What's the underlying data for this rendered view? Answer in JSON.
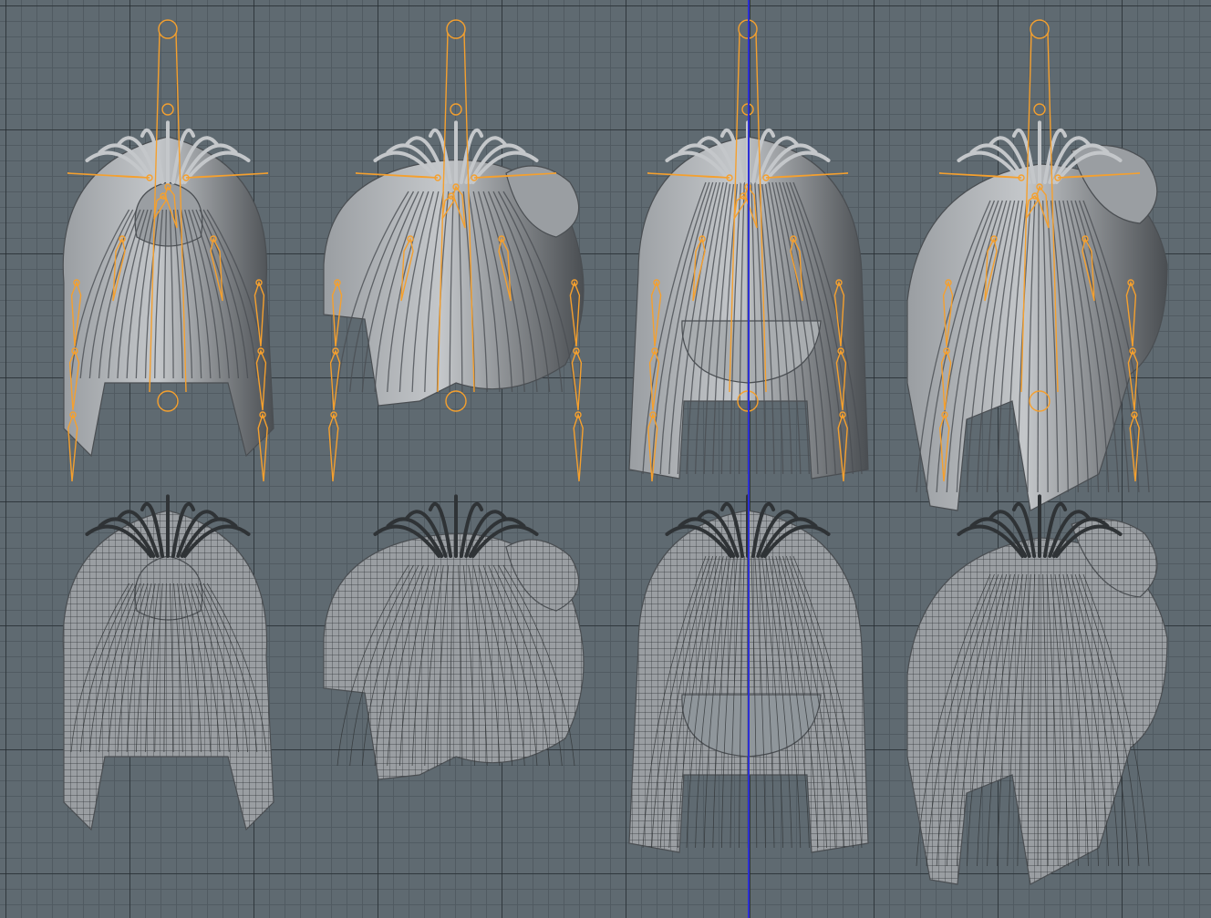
{
  "viewport": {
    "background": "#5f6a71",
    "grid_major_color": "#262c31",
    "grid_minor_color": "#505a60",
    "axis_color": "#2b2ed6"
  },
  "colors": {
    "rig": "#f5a02e",
    "hair_light": "#c4c7ca",
    "hair_mid": "#9a9ea2",
    "hair_dark": "#4a4e52",
    "wire": "#2f3336"
  },
  "models": [
    {
      "view": "back",
      "style": "shaded",
      "rig": true
    },
    {
      "view": "side",
      "style": "shaded",
      "rig": true
    },
    {
      "view": "front",
      "style": "shaded",
      "rig": true
    },
    {
      "view": "three-quarter",
      "style": "shaded",
      "rig": true
    },
    {
      "view": "back",
      "style": "wireframe",
      "rig": false
    },
    {
      "view": "side",
      "style": "wireframe",
      "rig": false
    },
    {
      "view": "front",
      "style": "wireframe",
      "rig": false
    },
    {
      "view": "three-quarter",
      "style": "wireframe",
      "rig": false
    }
  ]
}
